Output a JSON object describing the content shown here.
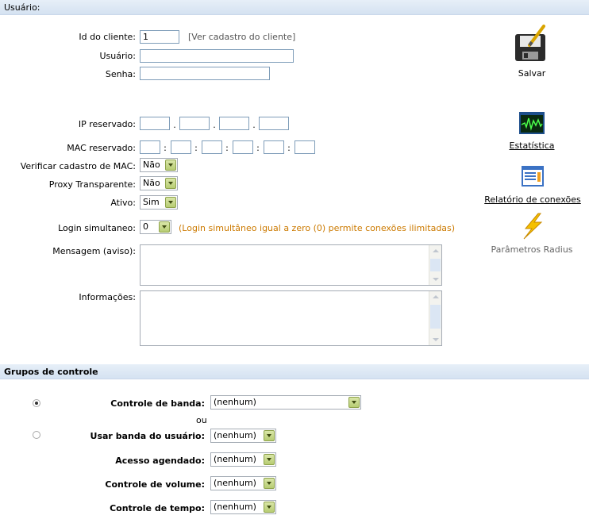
{
  "section_user": {
    "title": "Usuário:"
  },
  "form": {
    "client_id": {
      "label": "Id do cliente:",
      "value": "1",
      "link": "[Ver cadastro do cliente]"
    },
    "user": {
      "label": "Usuário:",
      "value": ""
    },
    "password": {
      "label": "Senha:",
      "value": ""
    },
    "ip": {
      "label": "IP reservado:",
      "octets": [
        "",
        "",
        "",
        ""
      ],
      "sep": "."
    },
    "mac": {
      "label": "MAC reservado:",
      "parts": [
        "",
        "",
        "",
        "",
        "",
        ""
      ],
      "sep": ":"
    },
    "verify_mac": {
      "label": "Verificar cadastro de MAC:",
      "value": "Não"
    },
    "proxy": {
      "label": "Proxy Transparente:",
      "value": "Não"
    },
    "active": {
      "label": "Ativo:",
      "value": "Sim"
    },
    "login_sim": {
      "label": "Login simultaneo:",
      "value": "0",
      "hint": "(Login simultâneo igual a zero (0) permite conexões ilimitadas)"
    },
    "message": {
      "label": "Mensagem (aviso):",
      "value": ""
    },
    "info": {
      "label": "Informações:",
      "value": ""
    }
  },
  "side": {
    "save": {
      "label": "Salvar",
      "icon": "floppy-disk-icon"
    },
    "stats": {
      "label": "Estatística",
      "icon": "monitor-graph-icon"
    },
    "report": {
      "label": "Relatório de conexões",
      "icon": "report-window-icon"
    },
    "radius": {
      "label": "Parâmetros Radius",
      "icon": "lightning-icon"
    }
  },
  "section_groups": {
    "title": "Grupos de controle"
  },
  "groups": {
    "bandwidth": {
      "label": "Controle de banda:",
      "value": "(nenhum)",
      "selected": true
    },
    "or": "ou",
    "user_band": {
      "label": "Usar banda do usuário:",
      "value": "(nenhum)",
      "selected": false
    },
    "scheduled": {
      "label": "Acesso agendado:",
      "value": "(nenhum)"
    },
    "volume": {
      "label": "Controle de volume:",
      "value": "(nenhum)"
    },
    "time": {
      "label": "Controle de tempo:",
      "value": "(nenhum)"
    }
  },
  "colors": {
    "hint": "#cc7a00",
    "header_bg": "#dce7f4",
    "select_arrow": "#b7cc73"
  }
}
